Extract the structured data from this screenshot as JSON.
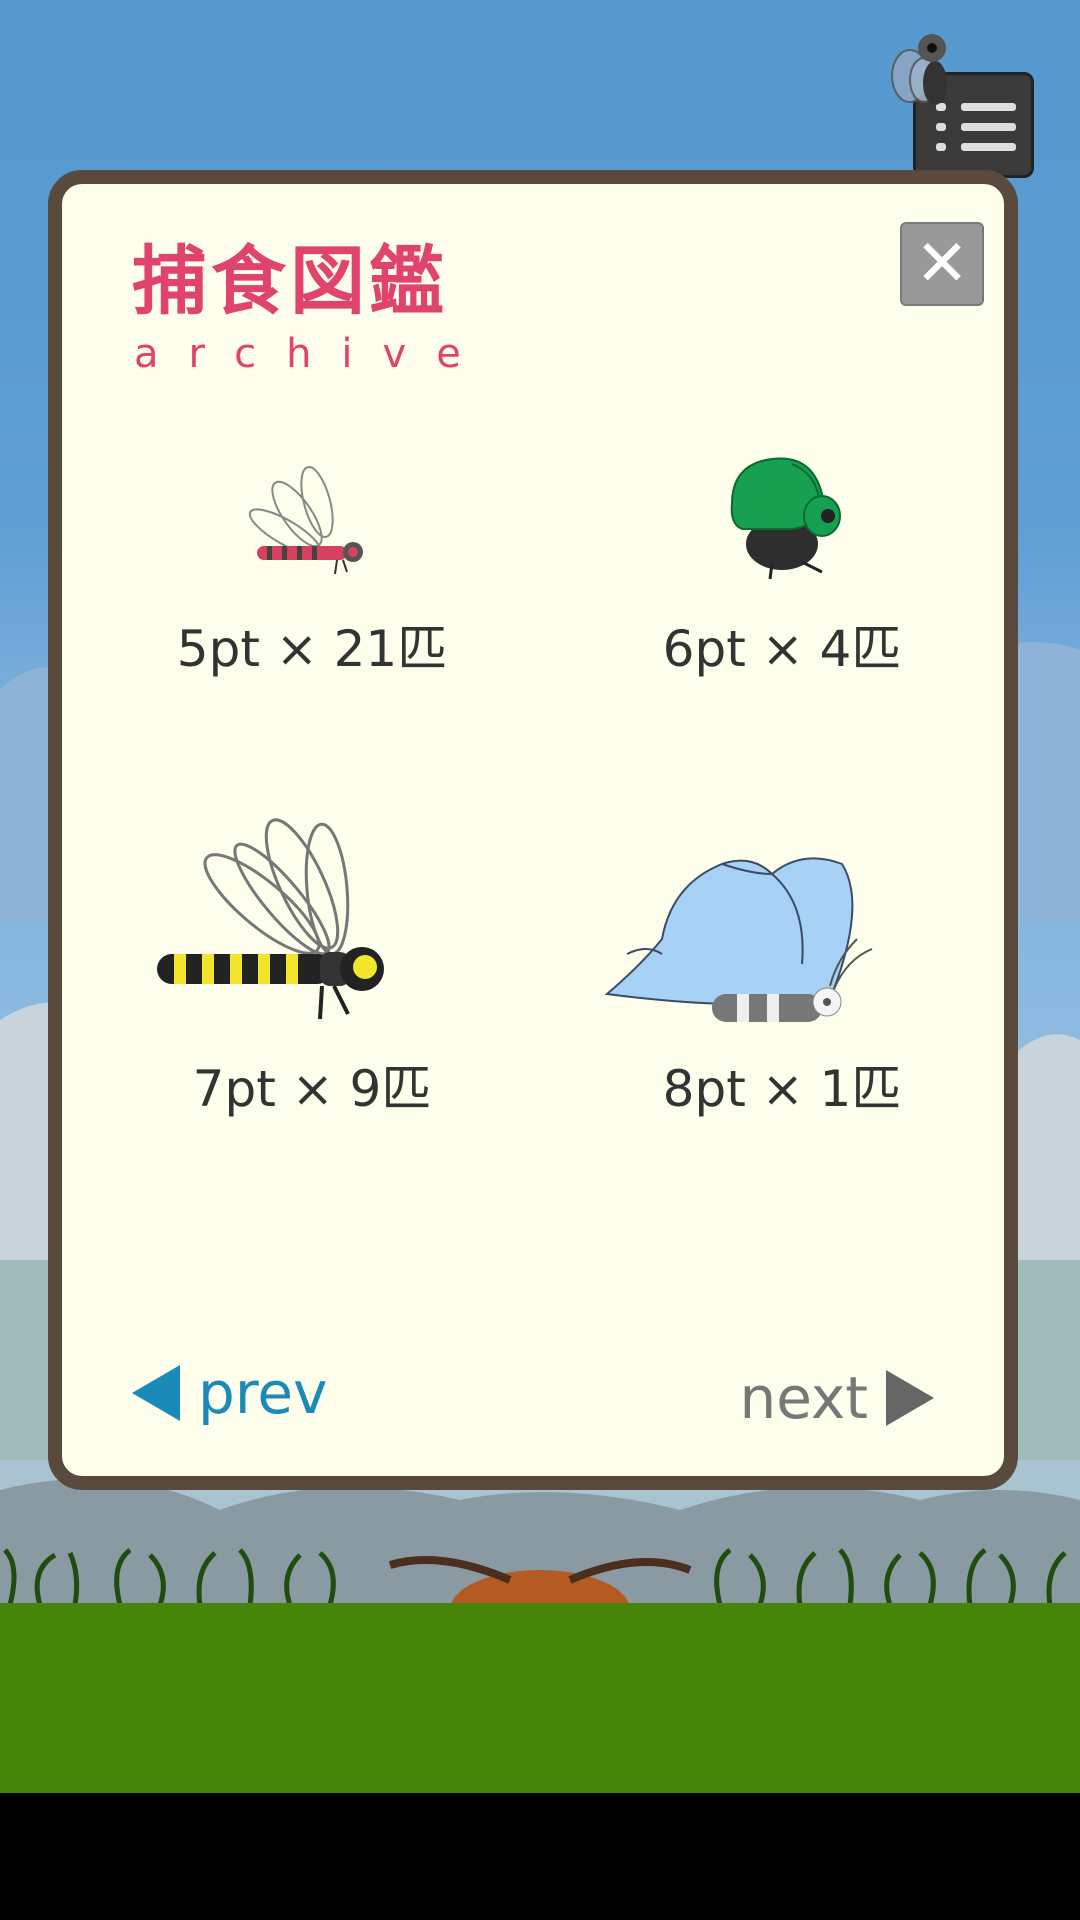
{
  "header": {
    "title_jp": "捕食図鑑",
    "title_en": "archive",
    "close_label": "✕"
  },
  "items": [
    {
      "label": "5pt × 21匹",
      "points": 5,
      "count": 21,
      "icon": "small-dragonfly-icon"
    },
    {
      "label": "6pt × 4匹",
      "points": 6,
      "count": 4,
      "icon": "green-beetle-icon"
    },
    {
      "label": "7pt × 9匹",
      "points": 7,
      "count": 9,
      "icon": "yellow-dragonfly-icon"
    },
    {
      "label": "8pt × 1匹",
      "points": 8,
      "count": 1,
      "icon": "blue-butterfly-icon"
    }
  ],
  "nav": {
    "prev_label": "prev",
    "next_label": "next"
  },
  "colors": {
    "title": "#e0436b",
    "prev": "#1a8ab8",
    "next": "#777777",
    "panel_bg": "#fefeec",
    "panel_border": "#5a4a3e",
    "sky": "#5599cf",
    "grass": "#478508"
  }
}
